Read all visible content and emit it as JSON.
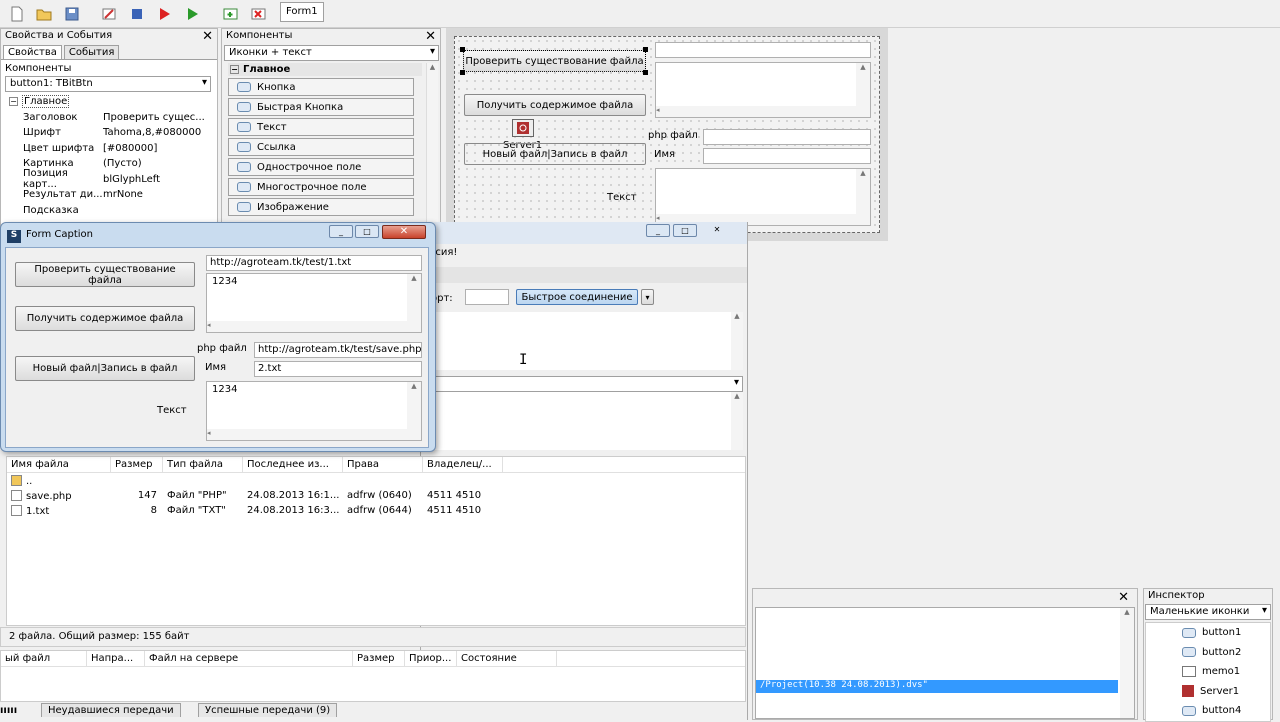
{
  "toolbar": {
    "form_tab": "Form1"
  },
  "props_panel": {
    "title": "Свойства и События",
    "tabs": [
      "Свойства",
      "События"
    ],
    "components_label": "Компоненты",
    "component_select": "button1: TBitBtn",
    "group": "Главное",
    "rows": [
      {
        "k": "Заголовок",
        "v": "Проверить сущес..."
      },
      {
        "k": "Шрифт",
        "v": "Tahoma,8,#080000"
      },
      {
        "k": "Цвет шрифта",
        "v": "[#080000]"
      },
      {
        "k": "Картинка",
        "v": "(Пусто)"
      },
      {
        "k": "Позиция карт...",
        "v": "blGlyphLeft"
      },
      {
        "k": "Результат ди...",
        "v": "mrNone"
      },
      {
        "k": "Подсказка",
        "v": ""
      }
    ]
  },
  "palette": {
    "title": "Компоненты",
    "view": "Иконки + текст",
    "group": "Главное",
    "items": [
      "Кнопка",
      "Быстрая Кнопка",
      "Текст",
      "Ссылка",
      "Однострочное поле",
      "Многострочное поле",
      "Изображение"
    ]
  },
  "designer": {
    "btn1": "Проверить существование файла",
    "btn2": "Получить содержимое файла",
    "btn3": "Новый файл|Запись в файл",
    "server": "Server1",
    "php_label": "php файл",
    "name_label": "Имя",
    "text_label": "Текст"
  },
  "form_window": {
    "title": "Form Caption",
    "btn1": "Проверить существование файла",
    "btn2": "Получить содержимое файла",
    "btn3": "Новый файл|Запись в файл",
    "url1": "http://agroteam.tk/test/1.txt",
    "memo1": "1234",
    "php_label": "php файл",
    "url2": "http://agroteam.tk/test/save.php",
    "name_label": "Имя",
    "name_value": "2.txt",
    "text_label": "Текст",
    "memo2": "1234"
  },
  "ftp": {
    "frag1": "рсия!",
    "port_label": "орт:",
    "quick_connect": "Быстрое соединение",
    "columns": [
      "Имя файла",
      "Размер",
      "Тип файла",
      "Последнее из...",
      "Права",
      "Владелец/..."
    ],
    "files": [
      {
        "name": "..",
        "size": "",
        "type": "",
        "date": "",
        "perm": "",
        "owner": ""
      },
      {
        "name": "save.php",
        "size": "147",
        "type": "Файл \"PHP\"",
        "date": "24.08.2013 16:1...",
        "perm": "adfrw (0640)",
        "owner": "4511 4510"
      },
      {
        "name": "1.txt",
        "size": "8",
        "type": "Файл \"TXT\"",
        "date": "24.08.2013 16:3...",
        "perm": "adfrw (0644)",
        "owner": "4511 4510"
      }
    ],
    "status": "2 файла. Общий размер: 155 байт",
    "queue_columns": [
      "ый файл",
      "Напра...",
      "Файл на сервере",
      "Размер",
      "Приор...",
      "Состояние"
    ],
    "queue_tabs": [
      "Неудавшиеся передачи",
      "Успешные передачи (9)"
    ]
  },
  "log": {
    "line": "/Project(10.38 24.08.2013).dvs\""
  },
  "inspector": {
    "title": "Инспектор",
    "view": "Маленькие иконки",
    "items": [
      "button1",
      "button2",
      "memo1",
      "Server1",
      "button4"
    ]
  }
}
